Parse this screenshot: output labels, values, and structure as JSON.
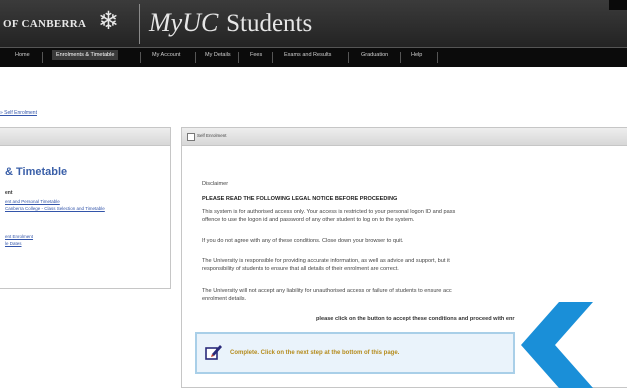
{
  "header": {
    "university": "OF CANBERRA",
    "brand_prefix": "MyUC",
    "brand_suffix": "Students",
    "logo_icon": "snowflake-crest-icon"
  },
  "nav": {
    "items": [
      {
        "label": "Home"
      },
      {
        "label": "Enrolments & Timetable",
        "active": true
      },
      {
        "label": "My Account"
      },
      {
        "label": "My Details"
      },
      {
        "label": "Fees"
      },
      {
        "label": "Exams and Results"
      },
      {
        "label": "Graduation"
      },
      {
        "label": "Help"
      }
    ]
  },
  "breadcrumb": "» Self Enrolment",
  "left": {
    "title": "& Timetable",
    "subtitle": "ent",
    "links": [
      "ent and Personal Timetable",
      "Canberra College - Class Selection and Timetable",
      "ent Enrolment",
      "le Dates"
    ]
  },
  "main": {
    "header_title": "Self Enrolment",
    "disclaimer": "Disclaimer",
    "heading": "PLEASE READ THE FOLLOWING LEGAL NOTICE BEFORE PROCEEDING",
    "para1_line1": "This system is for authorised access only. Your access is restricted to your personal logon ID and pass",
    "para1_line2": "offence to use the logon id and password of any other student to log on to the system.",
    "para2": "If you do not agree with any of these conditions. Close down your browser to quit.",
    "para3_line1": "The University is responsible for providing accurate information, as well as advice and support, but it",
    "para3_line2": "responsibility of students to ensure that all details of their enrolment are correct.",
    "para4_line1": "The University will not accept any liability for unauthorised access or failure of students to ensure acc",
    "para4_line2": "enrolment details.",
    "accept_prompt": "please click on the button to accept these conditions and proceed with enr",
    "notice": "Complete. Click on the next step at the bottom of this page.",
    "notice_icon": "edit-pencil-icon"
  },
  "colors": {
    "header_bg": "#2d2d2d",
    "nav_bg": "#0b0b0b",
    "link": "#3355aa",
    "title_blue": "#3a5fa8",
    "notice_bg": "#eaf3fb",
    "notice_border": "#a9cfe8",
    "notice_text": "#b58c1e",
    "chevron": "#1a8fd8"
  }
}
